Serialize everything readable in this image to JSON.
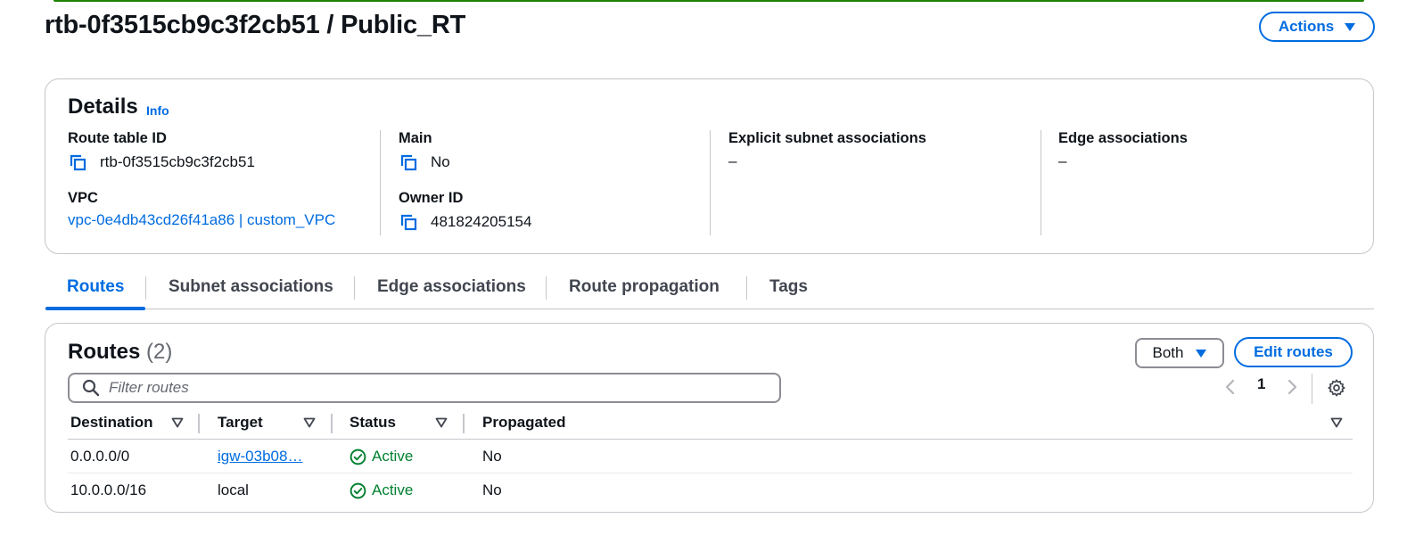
{
  "header": {
    "title": "rtb-0f3515cb9c3f2cb51 / Public_RT",
    "actions_label": "Actions"
  },
  "details": {
    "title": "Details",
    "info_label": "Info",
    "route_table_id_label": "Route table ID",
    "route_table_id": "rtb-0f3515cb9c3f2cb51",
    "main_label": "Main",
    "main_value": "No",
    "explicit_subnet_label": "Explicit subnet associations",
    "explicit_subnet_value": "–",
    "edge_assoc_label": "Edge associations",
    "edge_assoc_value": "–",
    "vpc_label": "VPC",
    "vpc_value": "vpc-0e4db43cd26f41a86 | custom_VPC",
    "owner_label": "Owner ID",
    "owner_value": "481824205154"
  },
  "tabs": [
    {
      "label": "Routes",
      "active": true
    },
    {
      "label": "Subnet associations",
      "active": false
    },
    {
      "label": "Edge associations",
      "active": false
    },
    {
      "label": "Route propagation",
      "active": false
    },
    {
      "label": "Tags",
      "active": false
    }
  ],
  "routes": {
    "title": "Routes",
    "count": "(2)",
    "filter_select": "Both",
    "edit_label": "Edit routes",
    "filter_placeholder": "Filter routes",
    "page": "1",
    "columns": [
      "Destination",
      "Target",
      "Status",
      "Propagated"
    ],
    "rows": [
      {
        "destination": "0.0.0.0/0",
        "target": "igw-03b08…",
        "target_link": true,
        "status": "Active",
        "propagated": "No"
      },
      {
        "destination": "10.0.0.0/16",
        "target": "local",
        "target_link": false,
        "status": "Active",
        "propagated": "No"
      }
    ]
  },
  "colors": {
    "accent": "#006ce0",
    "success": "#00802f",
    "banner_green": "#1d8102"
  }
}
